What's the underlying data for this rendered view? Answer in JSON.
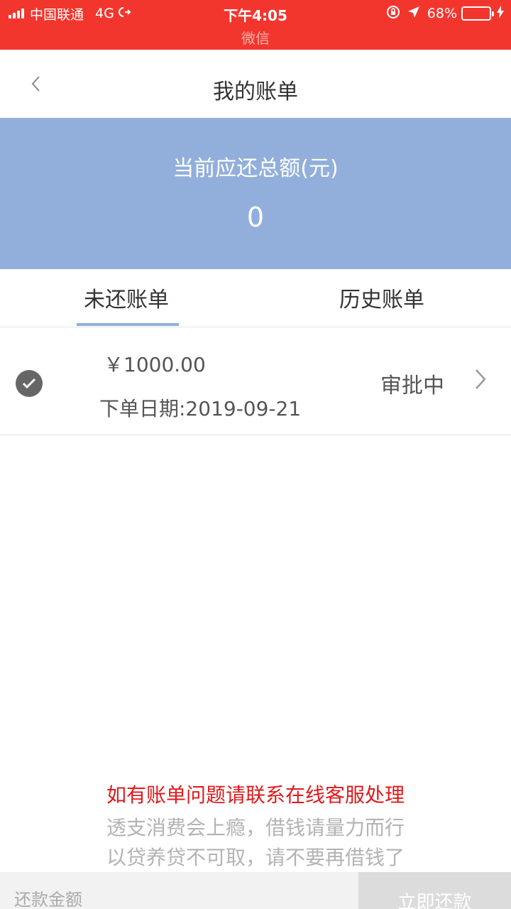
{
  "status_bar": {
    "carrier": "中国联通",
    "network": "4G",
    "time": "下午4:05",
    "battery": "68%",
    "battery_level": 0.68,
    "subtitle": "微信"
  },
  "nav": {
    "title": "我的账单"
  },
  "summary": {
    "label": "当前应还总额(元)",
    "value": "0"
  },
  "tabs": [
    {
      "label": "未还账单",
      "active": true
    },
    {
      "label": "历史账单",
      "active": false
    }
  ],
  "bill": {
    "amount": "￥1000.00",
    "date": "下单日期:2019-09-21",
    "status": "审批中"
  },
  "notices": {
    "red": "如有账单问题请联系在线客服处理",
    "gray1": "透支消费会上瘾，借钱请量力而行",
    "gray2": "以贷养贷不可取，请不要再借钱了"
  },
  "bottom": {
    "amount_placeholder": "还款金额",
    "pay_label": "立即还款"
  },
  "colors": {
    "status_bar": "#f2362e",
    "summary_bg": "#92afdc",
    "notice_red": "#e0191c"
  }
}
